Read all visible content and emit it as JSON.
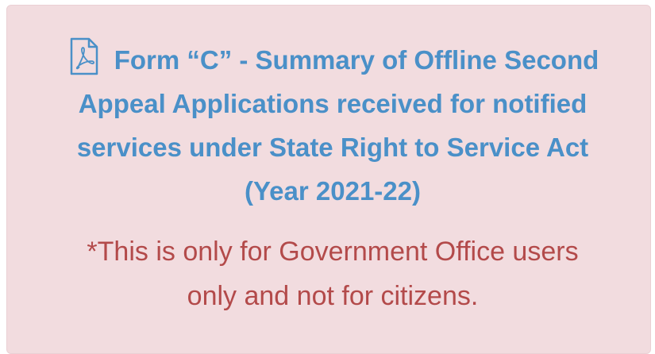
{
  "colors": {
    "card_background": "#f2dcdf",
    "link": "#4a90c8",
    "notice": "#b34a4a"
  },
  "form_link": {
    "icon": "pdf-file-icon",
    "lines": [
      "Form “C” - Summary of Offline Second",
      "Appeal Applications received for notified",
      "services under State Right to Service Act",
      "(Year 2021-22)"
    ]
  },
  "notice": {
    "lines": [
      "*This is only for Government Office users",
      "only and not for citizens."
    ]
  }
}
